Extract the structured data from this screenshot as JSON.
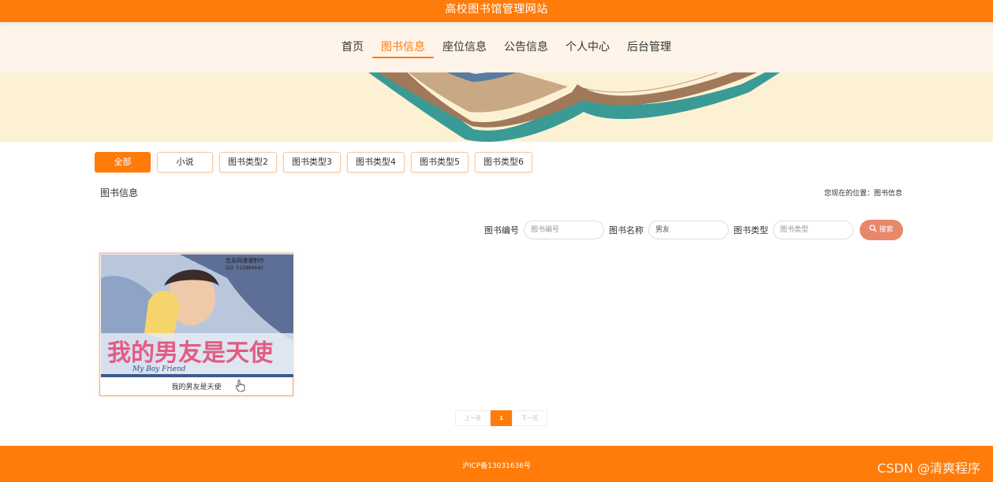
{
  "header": {
    "site_title": "高校图书馆管理网站"
  },
  "nav": {
    "items": [
      "首页",
      "图书信息",
      "座位信息",
      "公告信息",
      "个人中心",
      "后台管理"
    ],
    "active_index": 1
  },
  "categories": {
    "items": [
      "全部",
      "小说",
      "图书类型2",
      "图书类型3",
      "图书类型4",
      "图书类型5",
      "图书类型6"
    ],
    "active_index": 0
  },
  "section": {
    "title": "图书信息",
    "breadcrumb": "您现在的位置：图书信息"
  },
  "search": {
    "book_no_label": "图书编号",
    "book_no_placeholder": "图书编号",
    "book_name_label": "图书名称",
    "book_name_value": "男友",
    "book_type_label": "图书类型",
    "book_type_placeholder": "图书类型",
    "button_label": "搜索"
  },
  "books": [
    {
      "name": "我的男友是天使",
      "cover_title": "我的男友是天使",
      "cover_sub": "My Boy Friend",
      "cover_credit": "恋友网漫漫制作",
      "cover_qq": "QQ: 512884640"
    }
  ],
  "pagination": {
    "prev": "上一页",
    "current": "1",
    "next": "下一页"
  },
  "footer": {
    "icp": "沪ICP备13031636号",
    "watermark": "CSDN @清爽程序"
  },
  "colors": {
    "primary": "#ff7b0a",
    "search_button": "#e8876a",
    "banner_bg": "#fdf1d4",
    "nav_bg": "#fff4ea"
  }
}
